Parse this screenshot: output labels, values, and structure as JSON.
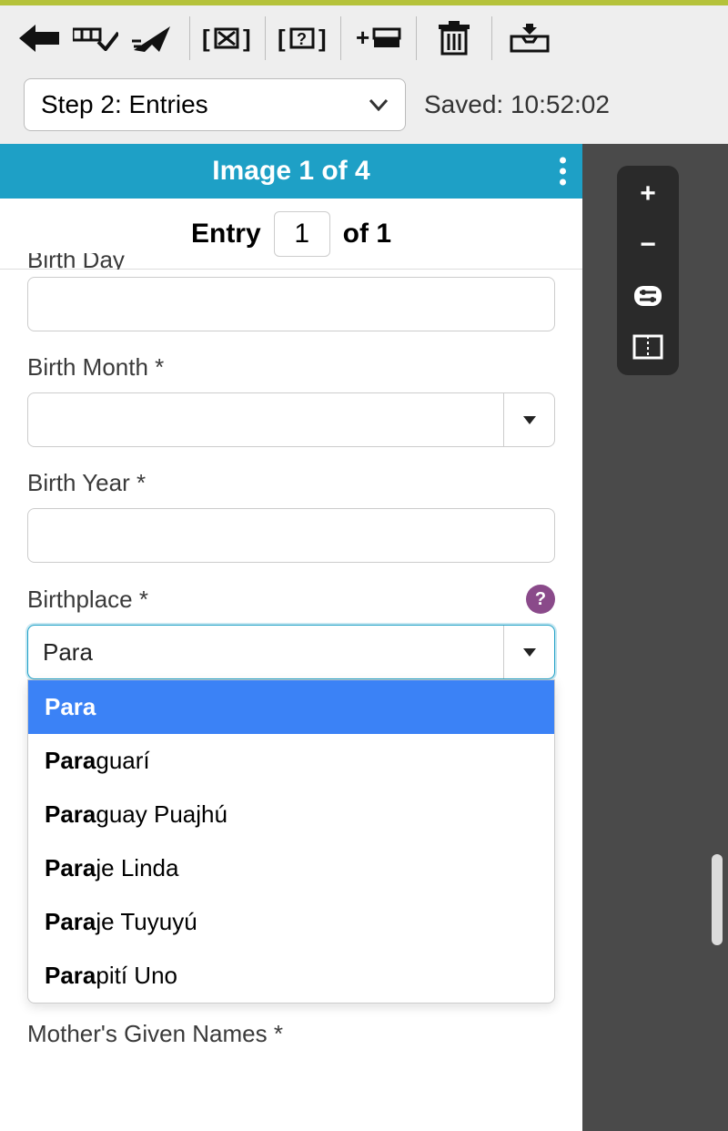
{
  "toolbar": {
    "icons": [
      "back",
      "batch-ok",
      "send",
      "mark-x",
      "mark-q",
      "add-row",
      "trash",
      "tray"
    ]
  },
  "step": {
    "selected": "Step 2: Entries"
  },
  "saved_label": "Saved:",
  "saved_time": "10:52:02",
  "image_bar": "Image 1 of 4",
  "entry": {
    "prefix": "Entry",
    "current": "1",
    "suffix": "of 1"
  },
  "fields": {
    "birth_day": {
      "label_cut": "Birth Day",
      "value": ""
    },
    "birth_month": {
      "label": "Birth Month *",
      "value": ""
    },
    "birth_year": {
      "label": "Birth Year *",
      "value": ""
    },
    "birthplace": {
      "label": "Birthplace *",
      "typed": "Para",
      "help": "?",
      "options": [
        {
          "match": "Para",
          "rest": ""
        },
        {
          "match": "Para",
          "rest": "guarí"
        },
        {
          "match": "Para",
          "rest": "guay Puajhú"
        },
        {
          "match": "Para",
          "rest": "je Linda"
        },
        {
          "match": "Para",
          "rest": "je Tuyuyú"
        },
        {
          "match": "Para",
          "rest": "pití Uno"
        }
      ]
    },
    "mothers_given": {
      "label": "Mother's Given Names *"
    }
  },
  "viewer": {
    "zoom_in": "+",
    "zoom_out": "−"
  }
}
